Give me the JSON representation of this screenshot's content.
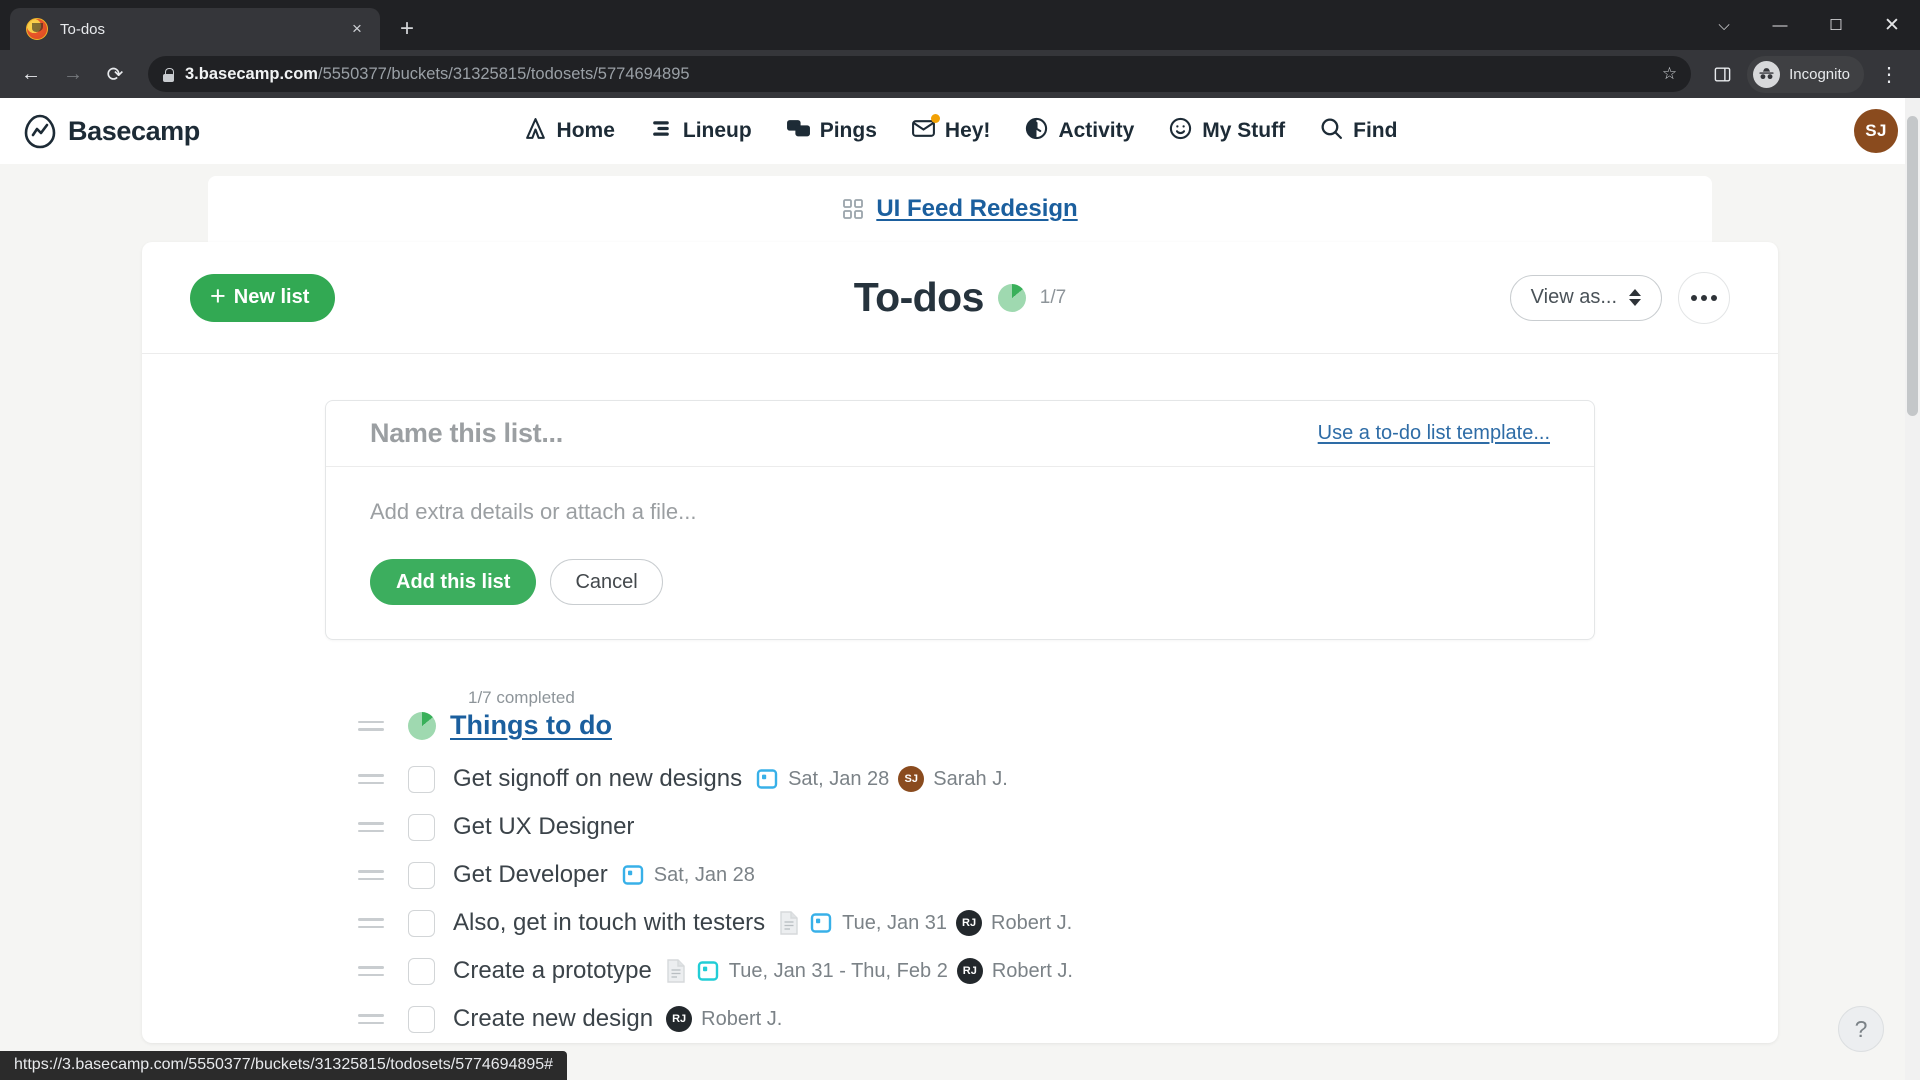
{
  "browser": {
    "tab": {
      "title": "To-dos",
      "favicon": "basecamp-favicon",
      "close": "×"
    },
    "newtab_label": "+",
    "window_controls": {
      "minimize_all": "⌵",
      "minimize": "—",
      "maximize": "☐",
      "close": "✕"
    },
    "nav": {
      "back": "←",
      "forward": "→",
      "reload": "⟳"
    },
    "url": {
      "domain": "3.basecamp.com",
      "path": "/5550377/buckets/31325815/todosets/5774694895"
    },
    "bookmark_icon": "☆",
    "sidepanel_icon": "sidepanel-icon",
    "incognito_label": "Incognito",
    "menu_icon": "⋮"
  },
  "statusbar": {
    "url": "https://3.basecamp.com/5550377/buckets/31325815/todosets/5774694895#"
  },
  "app": {
    "logo_text": "Basecamp",
    "nav_items": [
      {
        "label": "Home",
        "icon": "home-icon"
      },
      {
        "label": "Lineup",
        "icon": "lineup-icon"
      },
      {
        "label": "Pings",
        "icon": "pings-icon"
      },
      {
        "label": "Hey!",
        "icon": "hey-icon",
        "badge": true
      },
      {
        "label": "Activity",
        "icon": "activity-icon"
      },
      {
        "label": "My Stuff",
        "icon": "mystuff-icon"
      },
      {
        "label": "Find",
        "icon": "search-icon"
      }
    ],
    "account_avatar": "SJ"
  },
  "project": {
    "name": "UI Feed Redesign",
    "icon": "grid-icon"
  },
  "page": {
    "new_list_button": "New list",
    "new_list_plus": "+",
    "title": "To-dos",
    "progress": "1/7",
    "view_as_button": "View as...",
    "more_button": "more-options"
  },
  "new_list_form": {
    "name_placeholder": "Name this list...",
    "template_link": "Use a to-do list template...",
    "details_placeholder": "Add extra details or attach a file...",
    "submit_label": "Add this list",
    "cancel_label": "Cancel"
  },
  "todo_list": {
    "completed_label": "1/7 completed",
    "title": "Things to do",
    "items": [
      {
        "text": "Get signoff on new designs",
        "has_doc": false,
        "date": "Sat, Jan 28",
        "date_type": "single",
        "assignee": "Sarah J.",
        "initials": "SJ",
        "avatar_color": "#8a4b1e",
        "checked": false
      },
      {
        "text": "Get UX Designer",
        "has_doc": false,
        "date": "",
        "date_type": "",
        "assignee": "",
        "initials": "",
        "avatar_color": "",
        "checked": false
      },
      {
        "text": "Get Developer",
        "has_doc": false,
        "date": "Sat, Jan 28",
        "date_type": "single",
        "assignee": "",
        "initials": "",
        "avatar_color": "",
        "checked": false
      },
      {
        "text": "Also, get in touch with testers",
        "has_doc": true,
        "date": "Tue, Jan 31",
        "date_type": "single",
        "assignee": "Robert J.",
        "initials": "RJ",
        "avatar_color": "#23282c",
        "checked": false
      },
      {
        "text": "Create a prototype",
        "has_doc": true,
        "date": "Tue, Jan 31 - Thu, Feb 2",
        "date_type": "range",
        "assignee": "Robert J.",
        "initials": "RJ",
        "avatar_color": "#23282c",
        "checked": false
      },
      {
        "text": "Create new design",
        "has_doc": false,
        "date": "",
        "date_type": "",
        "assignee": "Robert J.",
        "initials": "RJ",
        "avatar_color": "#23282c",
        "checked": false
      }
    ]
  },
  "help_button": "?",
  "colors": {
    "brand_green": "#32a953",
    "link_blue": "#1b5f9e",
    "date_blue": "#38b0e8",
    "date_teal": "#22cdd6",
    "dark_text": "#26333d"
  }
}
